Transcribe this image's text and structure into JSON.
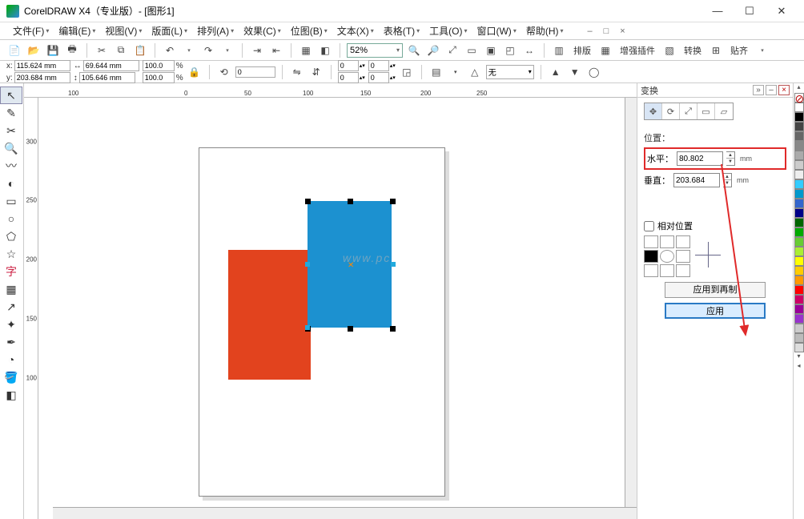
{
  "title": "CorelDRAW X4（专业版）- [图形1]",
  "menus": [
    "文件(F)",
    "编辑(E)",
    "视图(V)",
    "版面(L)",
    "排列(A)",
    "效果(C)",
    "位图(B)",
    "文本(X)",
    "表格(T)",
    "工具(O)",
    "窗口(W)",
    "帮助(H)"
  ],
  "doc_buttons": [
    "–",
    "□",
    "×"
  ],
  "toolbar": {
    "zoom": "52%",
    "groups": {
      "layout": "排版",
      "enhance": "增强插件",
      "convert": "转换",
      "paste": "贴齐"
    }
  },
  "propbar": {
    "x_label": "x:",
    "y_label": "y:",
    "x": "115.624 mm",
    "y": "203.684 mm",
    "w": "69.644 mm",
    "h": "105.646 mm",
    "sx": "100.0",
    "sy": "100.0",
    "rot": "0",
    "units": "%",
    "fill": "无"
  },
  "ruler_h": {
    "m100": "100",
    "0": "0",
    "50": "50",
    "100": "100",
    "150": "150",
    "200": "200",
    "250": "250"
  },
  "ruler_v": {
    "300": "300",
    "250": "250",
    "200": "200",
    "150": "150",
    "100": "100"
  },
  "watermark": "www.pc",
  "docker": {
    "title": "变换",
    "section": "位置：",
    "horiz_label": "水平：",
    "horiz_value": "80.802",
    "horiz_unit": "mm",
    "vert_label": "垂直：",
    "vert_value": "203.684",
    "vert_unit": "mm",
    "relative": "相对位置",
    "apply_copy": "应用到再制",
    "apply": "应用"
  },
  "palette_colors": [
    "#fff",
    "#000",
    "#444",
    "#666",
    "#888",
    "#aaa",
    "#ccc",
    "#eee",
    "#3cf",
    "#09c",
    "#36c",
    "#008",
    "#060",
    "#0a0",
    "#6c3",
    "#ae3",
    "#ff0",
    "#fc0",
    "#f90",
    "#f00",
    "#c06",
    "#909",
    "#93c",
    "#ccc",
    "#bbb",
    "#ddd"
  ]
}
